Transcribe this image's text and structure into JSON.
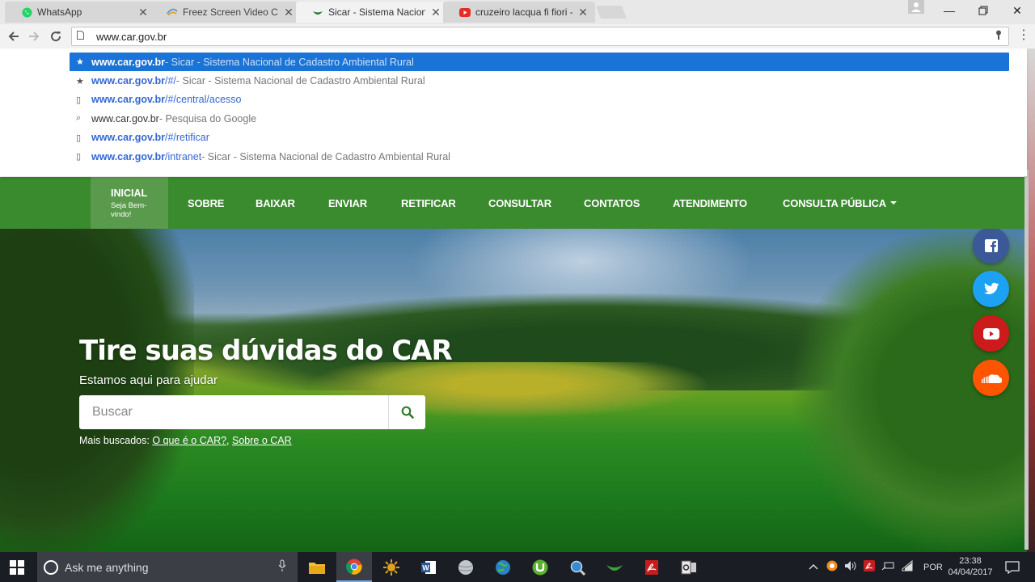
{
  "browser": {
    "tabs": [
      {
        "title": "WhatsApp",
        "icon": "whatsapp-icon",
        "color": "#25d366"
      },
      {
        "title": "Freez Screen Video Captu",
        "icon": "freez-icon",
        "color": "#5aa0d8"
      },
      {
        "title": "Sicar - Sistema Nacional",
        "icon": "sicar-icon",
        "color": "#1f7a2a"
      },
      {
        "title": "cruzeiro lacqua fi fiori - Y",
        "icon": "youtube-icon",
        "color": "#e52d27"
      }
    ],
    "address": "www.car.gov.br",
    "suggestions": [
      {
        "icon": "★",
        "url_bold": "www.car.gov.br",
        "url_rest": "",
        "title": " - Sicar - Sistema Nacional de Cadastro Ambiental Rural"
      },
      {
        "icon": "★",
        "url_bold": "www.car.gov.br",
        "url_rest": "/#/",
        "title": " - Sicar - Sistema Nacional de Cadastro Ambiental Rural"
      },
      {
        "icon": "▯",
        "url_bold": "www.car.gov.br",
        "url_rest": "/#/central/acesso",
        "title": ""
      },
      {
        "icon": "⌕",
        "url_bold": "",
        "url_rest": "www.car.gov.br",
        "title": " - Pesquisa do Google"
      },
      {
        "icon": "▯",
        "url_bold": "www.car.gov.br",
        "url_rest": "/#/retificar",
        "title": ""
      },
      {
        "icon": "▯",
        "url_bold": "www.car.gov.br",
        "url_rest": "/intranet",
        "title": " - Sicar - Sistema Nacional de Cadastro Ambiental Rural"
      }
    ]
  },
  "nav": {
    "home_label": "INICIAL",
    "home_sub": "Seja Bem-vindo!",
    "items": [
      "SOBRE",
      "BAIXAR",
      "ENVIAR",
      "RETIFICAR",
      "CONSULTAR",
      "CONTATOS",
      "ATENDIMENTO",
      "CONSULTA PÚBLICA"
    ]
  },
  "hero": {
    "title": "Tire suas dúvidas do CAR",
    "subtitle": "Estamos aqui para ajudar",
    "search_placeholder": "Buscar",
    "popular_label": "Mais buscados: ",
    "popular_links": [
      "O que é o CAR?",
      "Sobre o CAR"
    ]
  },
  "social": [
    {
      "name": "facebook-icon",
      "color": "#3b5998"
    },
    {
      "name": "twitter-icon",
      "color": "#1da1f2"
    },
    {
      "name": "youtube-icon",
      "color": "#cc1b1b"
    },
    {
      "name": "soundcloud-icon",
      "color": "#ff5500"
    }
  ],
  "taskbar": {
    "search_placeholder": "Ask me anything",
    "language": "POR",
    "time": "23:38",
    "date": "04/04/2017"
  },
  "colors": {
    "nav_green": "#3a8a2e",
    "suggestion_highlight": "#1a73d6"
  }
}
